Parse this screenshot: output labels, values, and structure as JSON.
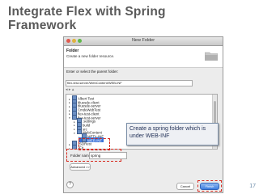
{
  "slide": {
    "title": "Integrate Flex with Spring Framework",
    "page_number": "17"
  },
  "dialog": {
    "window_title": "New Folder",
    "header_title": "Folder",
    "header_description": "Create a new folder resource.",
    "parent_prompt": "Enter or select the parent folder:",
    "parent_path": "flex-test-server/WebContent/WEB-INF",
    "tree_items": [
      {
        "label": "Albert Test",
        "level": 0,
        "expanded": false
      },
      {
        "label": "bluesde-client",
        "level": 0,
        "expanded": false
      },
      {
        "label": "bluesde-server",
        "level": 0,
        "expanded": false
      },
      {
        "label": "CmdeWebTest",
        "level": 0,
        "expanded": false
      },
      {
        "label": "flex-test-client",
        "level": 0,
        "expanded": false
      },
      {
        "label": "flex-test-server",
        "level": 0,
        "expanded": true
      },
      {
        "label": ".settings",
        "level": 1,
        "expanded": false
      },
      {
        "label": "build",
        "level": 1,
        "expanded": false
      },
      {
        "label": "src",
        "level": 1,
        "expanded": false
      },
      {
        "label": "WebContent",
        "level": 1,
        "expanded": true
      },
      {
        "label": "META-INF",
        "level": 2,
        "expanded": false
      },
      {
        "label": "WEB-INF",
        "level": 2,
        "expanded": false,
        "selected": true
      },
      {
        "label": "JSDRest",
        "level": 0,
        "expanded": false
      },
      {
        "label": "JFit",
        "level": 0,
        "expanded": false
      }
    ],
    "folder_name_label": "Folder name:",
    "folder_name_value": "spring",
    "advanced_label": "Advanced >>",
    "help_label": "?",
    "cancel_label": "Cancel",
    "finish_label": "Finish"
  },
  "callout": {
    "text": "Create a spring folder which is under WEB-INF"
  },
  "colors": {
    "title": "#5a5a5a",
    "highlight": "#d6281d",
    "selection": "#3a72d8",
    "finish_button": "#3f7fe0"
  }
}
